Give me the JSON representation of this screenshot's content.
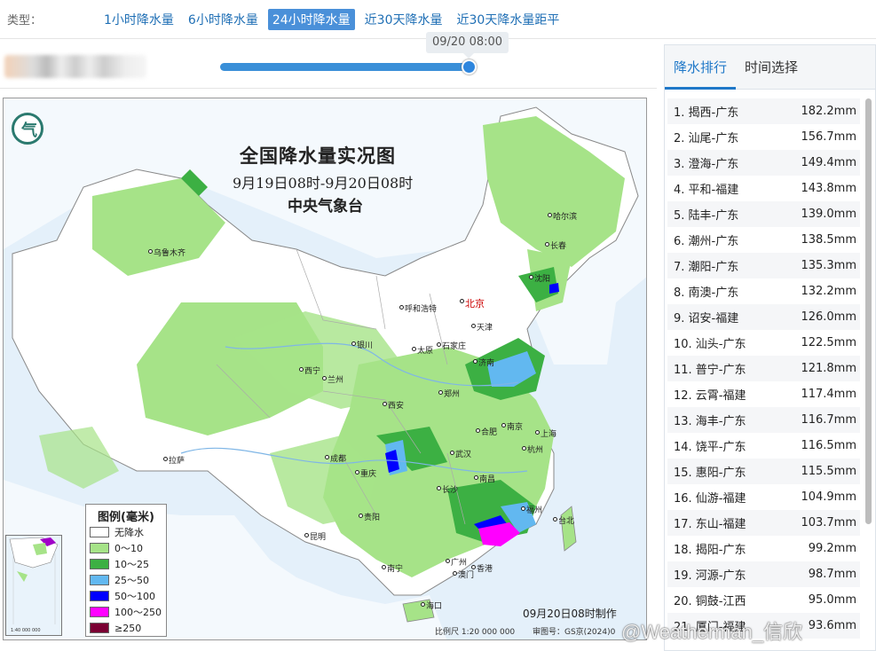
{
  "typebar": {
    "label": "类型：",
    "tabs": [
      {
        "label": "1小时降水量",
        "active": false
      },
      {
        "label": "6小时降水量",
        "active": false
      },
      {
        "label": "24小时降水量",
        "active": true
      },
      {
        "label": "近30天降水量",
        "active": false
      },
      {
        "label": "近30天降水量距平",
        "active": false
      }
    ]
  },
  "slider": {
    "time": "09/20 08:00",
    "progress": 1.0
  },
  "map": {
    "title": "全国降水量实况图",
    "subtitle": "9月19日08时-9月20日08时",
    "agency": "中央气象台",
    "made": "09月20日08时制作",
    "scale": "比例尺 1:20 000 000",
    "review": "审图号：GS京(2024)0",
    "inset_caption": "1:40 000 000",
    "cities": {
      "beijing": "北京",
      "tianjin": "天津",
      "harbin": "哈尔滨",
      "changchun": "长春",
      "shenyang": "沈阳",
      "urumqi": "乌鲁木齐",
      "hohhot": "呼和浩特",
      "yinchuan": "银川",
      "taiyuan": "太原",
      "shijiazhuang": "石家庄",
      "jinan": "济南",
      "xining": "西宁",
      "lanzhou": "兰州",
      "xian": "西安",
      "zhengzhou": "郑州",
      "nanjing": "南京",
      "hefei": "合肥",
      "shanghai": "上海",
      "hangzhou": "杭州",
      "wuhan": "武汉",
      "lhasa": "拉萨",
      "chengdu": "成都",
      "chongqing": "重庆",
      "changsha": "长沙",
      "nanchang": "南昌",
      "fuzhou": "福州",
      "taibei": "台北",
      "guiyang": "贵阳",
      "kunming": "昆明",
      "guangzhou": "广州",
      "hongkong": "香港",
      "macau": "澳门",
      "nanning": "南宁",
      "haikou": "海口"
    },
    "legend": {
      "title": "图例(毫米)",
      "items": [
        {
          "label": "无降水",
          "color": "#ffffff"
        },
        {
          "label": "0～10",
          "color": "#a6e388"
        },
        {
          "label": "10～25",
          "color": "#3cb043"
        },
        {
          "label": "25～50",
          "color": "#62b8f0"
        },
        {
          "label": "50～100",
          "color": "#0000ff"
        },
        {
          "label": "100～250",
          "color": "#ff00ff"
        },
        {
          "label": "≥250",
          "color": "#7a0033"
        }
      ]
    }
  },
  "panel": {
    "tabs": [
      {
        "label": "降水排行",
        "active": true
      },
      {
        "label": "时间选择",
        "active": false
      }
    ],
    "ranking": [
      {
        "name": "1. 揭西-广东",
        "value": "182.2mm"
      },
      {
        "name": "2. 汕尾-广东",
        "value": "156.7mm"
      },
      {
        "name": "3. 澄海-广东",
        "value": "149.4mm"
      },
      {
        "name": "4. 平和-福建",
        "value": "143.8mm"
      },
      {
        "name": "5. 陆丰-广东",
        "value": "139.0mm"
      },
      {
        "name": "6. 潮州-广东",
        "value": "138.5mm"
      },
      {
        "name": "7. 潮阳-广东",
        "value": "135.3mm"
      },
      {
        "name": "8. 南澳-广东",
        "value": "132.2mm"
      },
      {
        "name": "9. 诏安-福建",
        "value": "126.0mm"
      },
      {
        "name": "10. 汕头-广东",
        "value": "122.5mm"
      },
      {
        "name": "11. 普宁-广东",
        "value": "121.8mm"
      },
      {
        "name": "12. 云霄-福建",
        "value": "117.4mm"
      },
      {
        "name": "13. 海丰-广东",
        "value": "116.7mm"
      },
      {
        "name": "14. 饶平-广东",
        "value": "116.5mm"
      },
      {
        "name": "15. 惠阳-广东",
        "value": "115.5mm"
      },
      {
        "name": "16. 仙游-福建",
        "value": "104.9mm"
      },
      {
        "name": "17. 东山-福建",
        "value": "103.7mm"
      },
      {
        "name": "18. 揭阳-广东",
        "value": "99.2mm"
      },
      {
        "name": "19. 河源-广东",
        "value": "98.7mm"
      },
      {
        "name": "20. 铜鼓-江西",
        "value": "95.0mm"
      },
      {
        "name": "21. 厦门-福建",
        "value": "93.6mm"
      }
    ]
  },
  "watermark": "@Weatherman_信欣"
}
